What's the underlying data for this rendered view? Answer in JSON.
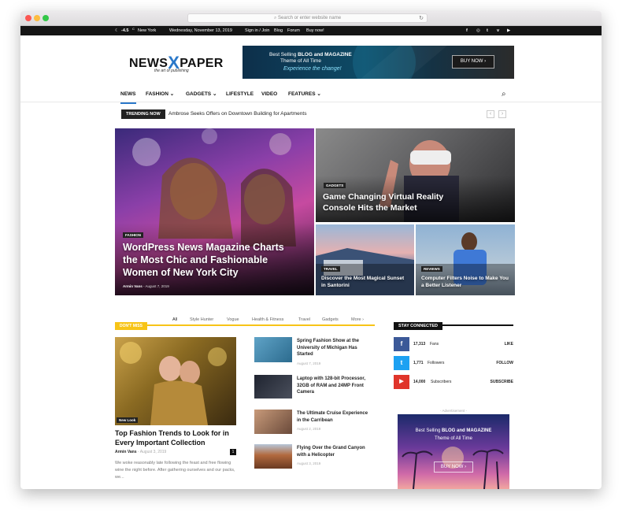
{
  "browser": {
    "url_placeholder": "Search or enter website name",
    "reload_icon": "reload-icon"
  },
  "topbar": {
    "temp": "-4.5",
    "deg": "C",
    "city": "New York",
    "date": "Wednesday, November 13, 2019",
    "links": [
      "Sign in / Join",
      "Blog",
      "Forum",
      "Buy now!"
    ],
    "social": [
      "f",
      "ig",
      "t",
      "v",
      "yt"
    ]
  },
  "logo": {
    "part1": "NEWS",
    "part2": "X",
    "part3": "PAPER",
    "tagline": "the art of publishing"
  },
  "banner": {
    "line1_pre": "Best Selling ",
    "line1_bold": "BLOG and MAGAZINE",
    "line2": "Theme of All Time",
    "line3": "Experience the change!",
    "button": "BUY NOW ›"
  },
  "nav": {
    "items": [
      "NEWS",
      "FASHION",
      "GADGETS",
      "LIFESTYLE",
      "VIDEO",
      "FEATURES"
    ],
    "chevrons": [
      "",
      "⌄",
      "⌄",
      "",
      "",
      "⌄"
    ],
    "search_icon": "⌕"
  },
  "trending": {
    "label": "TRENDING NOW",
    "headline": "Ambrose Seeks Offers on Downtown Building for Apartments",
    "prev": "‹",
    "next": "›"
  },
  "hero": {
    "main": {
      "cat": "FASHION",
      "title": "WordPress News Magazine Charts the Most Chic and Fashionable Women of New York City",
      "author": "Armin Vans",
      "date": "August 7, 2019"
    },
    "vr": {
      "cat": "GADGETS",
      "title": "Game Changing Virtual Reality Console Hits the Market"
    },
    "travel": {
      "cat": "TRAVEL",
      "title": "Discover the Most Magical Sunset in Santorini"
    },
    "reviews": {
      "cat": "REVIEWS",
      "title": "Computer Filters Noise to Make You a Better Listener"
    }
  },
  "dontmiss": {
    "label": "DON'T MISS",
    "filters": [
      "All",
      "Style Hunter",
      "Vogue",
      "Health & Fitness",
      "Travel",
      "Gadgets",
      "More"
    ],
    "feature": {
      "cat": "New Look",
      "title": "Top Fashion Trends to Look for in Every Important Collection",
      "author": "Armin Vans",
      "date": "August 3, 2019",
      "comments": "1",
      "excerpt": "We woke reasonably late following the feast and free flowing wine the night before. After gathering ourselves and our packs, we..."
    },
    "list": [
      {
        "title": "Spring Fashion Show at the University of Michigan Has Started",
        "date": "August 7, 2019"
      },
      {
        "title": "Laptop with 128-bit Processor, 32GB of RAM and 24MP Front Camera",
        "date": "August 5, 2019"
      },
      {
        "title": "The Ultimate Cruise Experience in the Carribean",
        "date": "August 2, 2019"
      },
      {
        "title": "Flying Over the Grand Canyon with a Helicopter",
        "date": "August 3, 2019"
      }
    ]
  },
  "stay": {
    "label": "STAY CONNECTED",
    "rows": [
      {
        "icon": "f",
        "count": "17,313",
        "label": "Fans",
        "action": "LIKE",
        "color": "#3b5998"
      },
      {
        "icon": "t",
        "count": "1,771",
        "label": "Followers",
        "action": "FOLLOW",
        "color": "#1da1f2"
      },
      {
        "icon": "▶",
        "count": "14,000",
        "label": "Subscribers",
        "action": "SUBSCRIBE",
        "color": "#e0352b"
      }
    ]
  },
  "ad": {
    "label": "- Advertisement -",
    "line1_pre": "Best Selling ",
    "line1_bold": "BLOG and MAGAZINE",
    "line2": "Theme of All Time",
    "button": "BUY NOW ›"
  }
}
